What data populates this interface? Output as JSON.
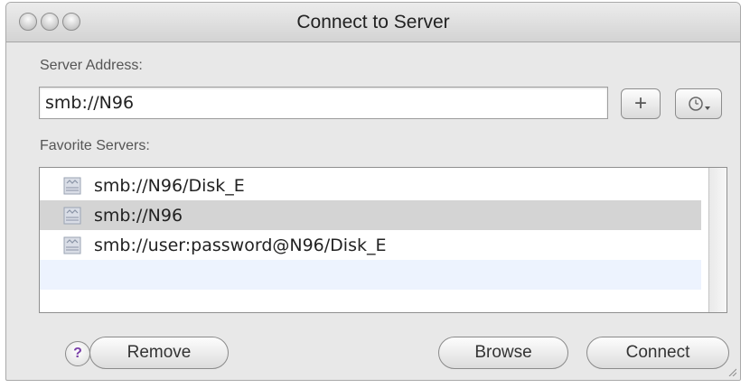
{
  "window": {
    "title": "Connect to Server"
  },
  "server_address": {
    "label": "Server Address:",
    "value": "smb://N96",
    "add_button": "+",
    "recent_icon": "clock-icon"
  },
  "favorites": {
    "label": "Favorite Servers:",
    "items": [
      {
        "label": "smb://N96/Disk_E",
        "icon": "network-drive-icon",
        "selected": false
      },
      {
        "label": "smb://N96",
        "icon": "network-drive-icon",
        "selected": true
      },
      {
        "label": "smb://user:password@N96/Disk_E",
        "icon": "network-drive-icon",
        "selected": false
      }
    ]
  },
  "footer": {
    "help_label": "?",
    "remove_label": "Remove",
    "browse_label": "Browse",
    "connect_label": "Connect"
  },
  "colors": {
    "selected_row": "#d4d4d4",
    "alt_row": "#edf3fe",
    "help_glyph": "#7a3fa8"
  }
}
